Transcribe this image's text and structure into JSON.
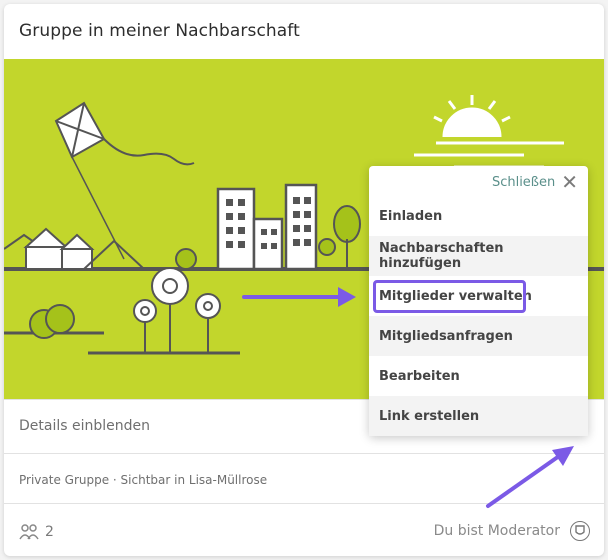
{
  "card": {
    "title": "Gruppe in meiner Nachbarschaft",
    "details_label": "Details einblenden",
    "privacy_text": "Private Gruppe · Sichtbar in Lisa-Müllrose",
    "member_count": "2",
    "moderator_label": "Du bist Moderator"
  },
  "menu": {
    "close_label": "Schließen",
    "items": [
      {
        "label": "Einladen"
      },
      {
        "label": "Nachbarschaften hinzufügen"
      },
      {
        "label": "Mitglieder verwalten"
      },
      {
        "label": "Mitgliedsanfragen"
      },
      {
        "label": "Bearbeiten"
      },
      {
        "label": "Link erstellen"
      }
    ]
  },
  "colors": {
    "hero_bg": "#c2d62c",
    "annotation": "#7b5ae6",
    "close_text": "#5a8f8a"
  },
  "icons": [
    "close-icon",
    "members-icon",
    "moderator-badge-icon"
  ]
}
